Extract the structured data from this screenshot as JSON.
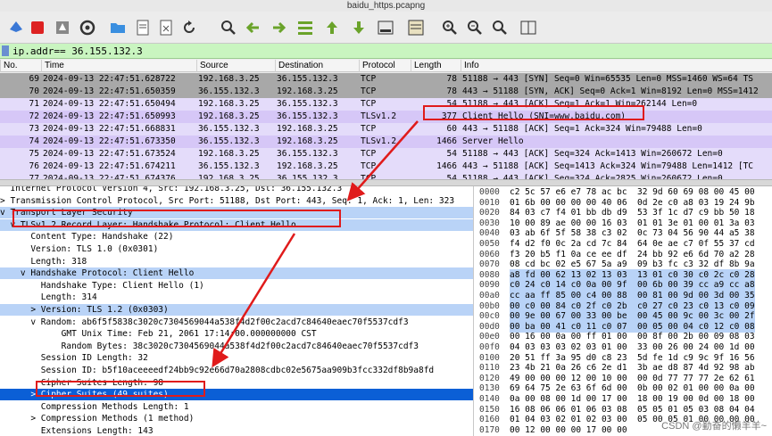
{
  "window": {
    "title": "baidu_https.pcapng"
  },
  "toolbar": {
    "icons": [
      "shark-start-icon",
      "stop-icon",
      "restart-icon",
      "options-icon",
      "open-folder-icon",
      "save-file-icon",
      "close-file-icon",
      "reload-icon",
      "find-icon",
      "back-arrow-icon",
      "forward-arrow-icon",
      "go-to-packet-icon",
      "first-packet-icon",
      "last-packet-icon",
      "autoscroll-icon",
      "colorize-icon",
      "zoom-in-icon",
      "zoom-out-icon",
      "normal-size-icon",
      "resize-columns-icon"
    ]
  },
  "filter": {
    "value": "ip.addr== 36.155.132.3"
  },
  "packet_list": {
    "columns": [
      "No.",
      "Time",
      "Source",
      "Destination",
      "Protocol",
      "Length",
      "Info"
    ],
    "rows": [
      {
        "no": "69",
        "time": "2024-09-13 22:47:51.628722",
        "src": "192.168.3.25",
        "dst": "36.155.132.3",
        "proto": "TCP",
        "len": "78",
        "info": "51188 → 443 [SYN] Seq=0 Win=65535 Len=0 MSS=1460 WS=64 TS",
        "style": "gray"
      },
      {
        "no": "70",
        "time": "2024-09-13 22:47:51.650359",
        "src": "36.155.132.3",
        "dst": "192.168.3.25",
        "proto": "TCP",
        "len": "78",
        "info": "443 → 51188 [SYN, ACK] Seq=0 Ack=1 Win=8192 Len=0 MSS=1412",
        "style": "gray"
      },
      {
        "no": "71",
        "time": "2024-09-13 22:47:51.650494",
        "src": "192.168.3.25",
        "dst": "36.155.132.3",
        "proto": "TCP",
        "len": "54",
        "info": "51188 → 443 [ACK] Seq=1 Ack=1 Win=262144 Len=0",
        "style": "lilac"
      },
      {
        "no": "72",
        "time": "2024-09-13 22:47:51.650993",
        "src": "192.168.3.25",
        "dst": "36.155.132.3",
        "proto": "TLSv1.2",
        "len": "377",
        "info": "Client Hello (SNI=www.baidu.com)",
        "style": "tls"
      },
      {
        "no": "73",
        "time": "2024-09-13 22:47:51.668831",
        "src": "36.155.132.3",
        "dst": "192.168.3.25",
        "proto": "TCP",
        "len": "60",
        "info": "443 → 51188 [ACK] Seq=1 Ack=324 Win=79488 Len=0",
        "style": "lilac"
      },
      {
        "no": "74",
        "time": "2024-09-13 22:47:51.673350",
        "src": "36.155.132.3",
        "dst": "192.168.3.25",
        "proto": "TLSv1.2",
        "len": "1466",
        "info": "Server Hello",
        "style": "tls"
      },
      {
        "no": "75",
        "time": "2024-09-13 22:47:51.673524",
        "src": "192.168.3.25",
        "dst": "36.155.132.3",
        "proto": "TCP",
        "len": "54",
        "info": "51188 → 443 [ACK] Seq=324 Ack=1413 Win=260672 Len=0",
        "style": "lilac"
      },
      {
        "no": "76",
        "time": "2024-09-13 22:47:51.674211",
        "src": "36.155.132.3",
        "dst": "192.168.3.25",
        "proto": "TCP",
        "len": "1466",
        "info": "443 → 51188 [ACK] Seq=1413 Ack=324 Win=79488 Len=1412 [TC",
        "style": "lilac"
      },
      {
        "no": "77",
        "time": "2024-09-13 22:47:51.674376",
        "src": "192.168.3.25",
        "dst": "36.155.132.3",
        "proto": "TCP",
        "len": "54",
        "info": "51188 → 443 [ACK] Seq=324 Ack=2825 Win=260672 Len=0",
        "style": "lilac"
      }
    ]
  },
  "details": {
    "lines": [
      {
        "text": "  Internet Protocol Version 4, Src: 192.168.3.25, Dst: 36.155.132.3",
        "style": ""
      },
      {
        "text": "> Transmission Control Protocol, Src Port: 51188, Dst Port: 443, Seq: 1, Ack: 1, Len: 323",
        "style": ""
      },
      {
        "text": "v Transport Layer Security",
        "style": "sel"
      },
      {
        "text": "  v TLSv1.2 Record Layer: Handshake Protocol: Client Hello",
        "style": "sel"
      },
      {
        "text": "      Content Type: Handshake (22)",
        "style": ""
      },
      {
        "text": "      Version: TLS 1.0 (0x0301)",
        "style": ""
      },
      {
        "text": "      Length: 318",
        "style": ""
      },
      {
        "text": "    v Handshake Protocol: Client Hello",
        "style": "sel"
      },
      {
        "text": "        Handshake Type: Client Hello (1)",
        "style": ""
      },
      {
        "text": "        Length: 314",
        "style": ""
      },
      {
        "text": "      > Version: TLS 1.2 (0x0303)",
        "style": "sel"
      },
      {
        "text": "      v Random: ab6f5f5838c3020c7304569044a538f4d2f00c2acd7c84640eaec70f5537cdf3",
        "style": ""
      },
      {
        "text": "            GMT Unix Time: Feb 21, 2061 17:14:00.000000000 CST",
        "style": ""
      },
      {
        "text": "            Random Bytes: 38c3020c7304569044a538f4d2f00c2acd7c84640eaec70f5537cdf3",
        "style": ""
      },
      {
        "text": "        Session ID Length: 32",
        "style": ""
      },
      {
        "text": "        Session ID: b5f10aceeeedf24bb9c92e66d70a2808cdbc02e5675aa909b3fcc332df8b9a8fd",
        "style": ""
      },
      {
        "text": "        Cipher Suites Length: 98",
        "style": ""
      },
      {
        "text": "      > Cipher Suites (49 suites)",
        "style": "hi"
      },
      {
        "text": "        Compression Methods Length: 1",
        "style": ""
      },
      {
        "text": "      > Compression Methods (1 method)",
        "style": ""
      },
      {
        "text": "        Extensions Length: 143",
        "style": ""
      }
    ]
  },
  "hex": {
    "rows": [
      {
        "off": "0000",
        "bytes": "c2 5c 57 e6 e7 78 ac bc  32 9d 60 69 08 00 45 00",
        "sel": false
      },
      {
        "off": "0010",
        "bytes": "01 6b 00 00 00 00 40 06  0d 2e c0 a8 03 19 24 9b",
        "sel": false
      },
      {
        "off": "0020",
        "bytes": "84 03 c7 f4 01 bb db d9  53 3f 1c d7 c9 bb 50 18",
        "sel": false
      },
      {
        "off": "0030",
        "bytes": "10 00 89 ae 00 00 16 03  01 01 3e 01 00 01 3a 03",
        "sel": false
      },
      {
        "off": "0040",
        "bytes": "03 ab 6f 5f 58 38 c3 02  0c 73 04 56 90 44 a5 38",
        "sel": false
      },
      {
        "off": "0050",
        "bytes": "f4 d2 f0 0c 2a cd 7c 84  64 0e ae c7 0f 55 37 cd",
        "sel": false
      },
      {
        "off": "0060",
        "bytes": "f3 20 b5 f1 0a ce ee df  24 bb 92 e6 6d 70 a2 28",
        "sel": false
      },
      {
        "off": "0070",
        "bytes": "08 cd bc 02 e5 67 5a a9  09 b3 fc c3 32 df 8b 9a",
        "sel": false
      },
      {
        "off": "0080",
        "bytes": "a8 fd 00 62 13 02 13 03  13 01 c0 30 c0 2c c0 28",
        "sel": true
      },
      {
        "off": "0090",
        "bytes": "c0 24 c0 14 c0 0a 00 9f  00 6b 00 39 cc a9 cc a8",
        "sel": true
      },
      {
        "off": "00a0",
        "bytes": "cc aa ff 85 00 c4 00 88  00 81 00 9d 00 3d 00 35",
        "sel": true
      },
      {
        "off": "00b0",
        "bytes": "00 c0 00 84 c0 2f c0 2b  c0 27 c0 23 c0 13 c0 09",
        "sel": true
      },
      {
        "off": "00c0",
        "bytes": "00 9e 00 67 00 33 00 be  00 45 00 9c 00 3c 00 2f",
        "sel": true
      },
      {
        "off": "00d0",
        "bytes": "00 ba 00 41 c0 11 c0 07  00 05 00 04 c0 12 c0 08",
        "sel": true
      },
      {
        "off": "00e0",
        "bytes": "00 16 00 0a 00 ff 01 00  00 8f 00 2b 00 09 08 03",
        "sel": false
      },
      {
        "off": "00f0",
        "bytes": "04 03 03 03 02 03 01 00  33 00 26 00 24 00 1d 00",
        "sel": false
      },
      {
        "off": "0100",
        "bytes": "20 51 ff 3a 95 d0 c8 23  5d fe 1d c9 9c 9f 16 56",
        "sel": false
      },
      {
        "off": "0110",
        "bytes": "23 4b 21 0a 26 c6 2e d1  3b ae d8 87 4d 92 98 ab",
        "sel": false
      },
      {
        "off": "0120",
        "bytes": "49 00 00 00 12 00 10 00  00 0d 77 77 77 2e 62 61",
        "sel": false
      },
      {
        "off": "0130",
        "bytes": "69 64 75 2e 63 6f 6d 00  0b 00 02 01 00 00 0a 00",
        "sel": false
      },
      {
        "off": "0140",
        "bytes": "0a 00 08 00 1d 00 17 00  18 00 19 00 0d 00 18 00",
        "sel": false
      },
      {
        "off": "0150",
        "bytes": "16 08 06 06 01 06 03 08  05 05 01 05 03 08 04 04",
        "sel": false
      },
      {
        "off": "0160",
        "bytes": "01 04 03 02 01 02 03 00  05 00 05 01 00 00 00 00",
        "sel": false
      },
      {
        "off": "0170",
        "bytes": "00 12 00 00 00 17 00 00",
        "sel": false
      }
    ]
  },
  "watermark": "CSDN @勤奋的懒羊羊~"
}
